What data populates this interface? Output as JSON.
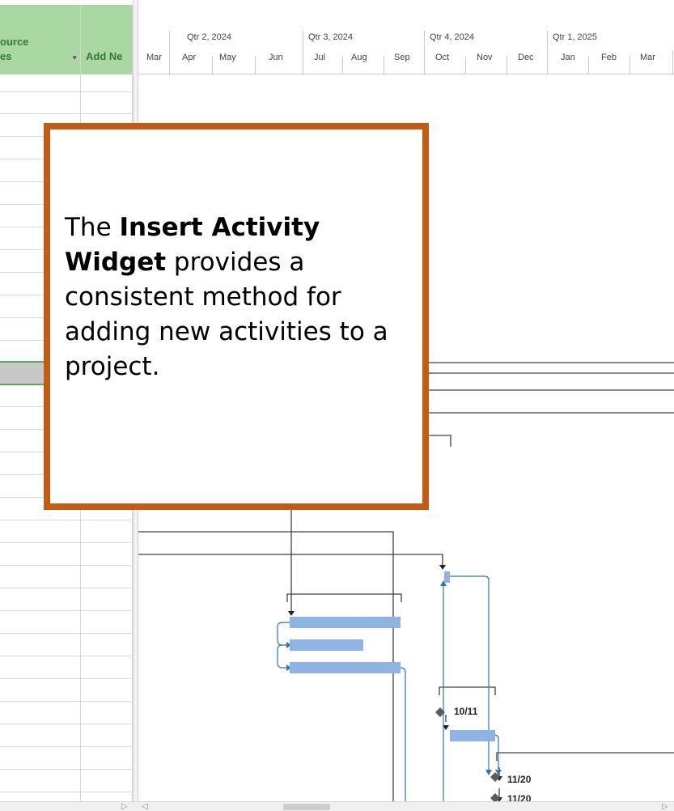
{
  "grid": {
    "columns": [
      {
        "line1": "ource",
        "line2": "es"
      },
      {
        "label": "Add Ne"
      }
    ],
    "dropdown_glyph": "▾"
  },
  "timeline": {
    "quarters": [
      "Qtr 2, 2024",
      "Qtr 3, 2024",
      "Qtr 4, 2024",
      "Qtr 1, 2025"
    ],
    "months": [
      "Mar",
      "Apr",
      "May",
      "Jun",
      "Jul",
      "Aug",
      "Sep",
      "Oct",
      "Nov",
      "Dec",
      "Jan",
      "Feb",
      "Mar"
    ]
  },
  "milestones": [
    "10/11",
    "11/20",
    "11/20"
  ],
  "callout": {
    "pre": "The ",
    "bold": "Insert Activity Widget",
    "post": " provides a consistent method for adding new activities to a project."
  },
  "colors": {
    "header_green": "#a9d8a2",
    "callout_border": "#c55a11",
    "task_bar": "#8db4e2",
    "link_blue": "#2e75b6"
  }
}
